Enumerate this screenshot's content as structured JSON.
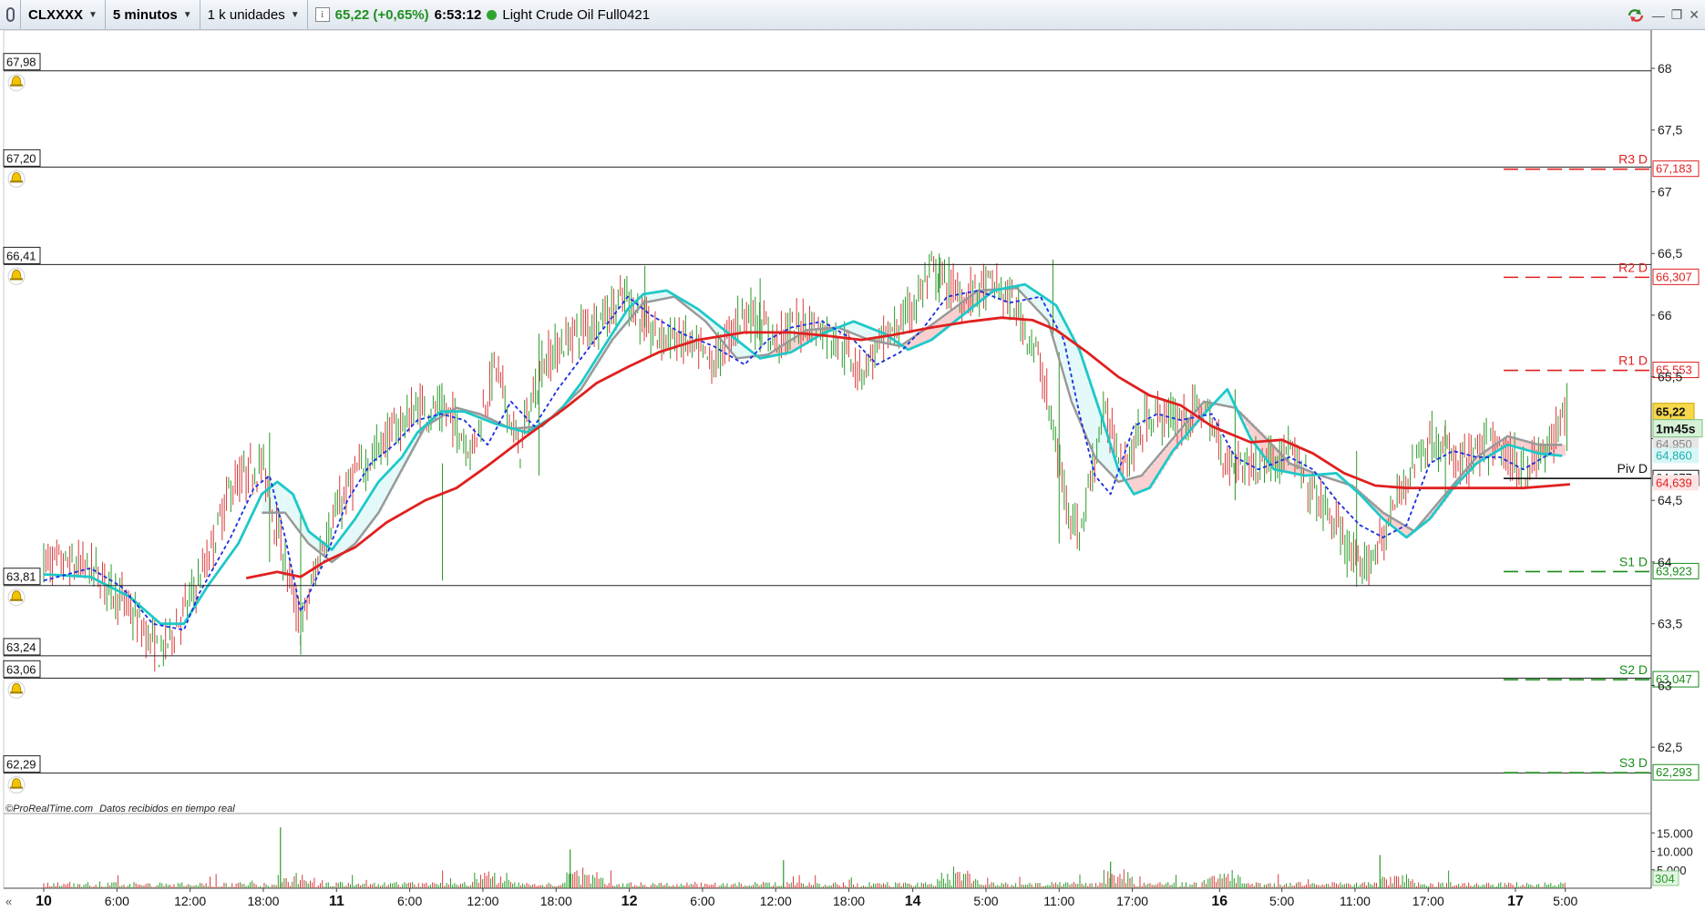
{
  "toolbar": {
    "symbol": "CLXXXX",
    "interval": "5 minutos",
    "units": "1 k unidades",
    "change": "65,22 (+0,65%)",
    "time": "6:53:12",
    "instrument": "Light Crude Oil Full0421"
  },
  "footer_note": {
    "brand": "©ProRealTime.com",
    "status": "Datos recibidos en tiempo real"
  },
  "colors": {
    "bull": "#2a9a2a",
    "bear": "#d83a3a",
    "ma_slow": "#e02020",
    "ma_cyan": "#1fc8c8",
    "ma_grey": "#999999",
    "dotted": "#1a2fe0",
    "resistance": "#e02020",
    "support": "#1a8c1a"
  },
  "chart_data": {
    "type": "line",
    "ylim": [
      61.97,
      68.31
    ],
    "y_ticks": [
      "68",
      "67,5",
      "67",
      "66,5",
      "66",
      "65,5",
      "65",
      "64,5",
      "64",
      "63,5",
      "63",
      "62,5"
    ],
    "x_ticks": [
      {
        "label": "10",
        "bold": true,
        "t": 0
      },
      {
        "label": "6:00",
        "bold": false,
        "t": 0.047
      },
      {
        "label": "12:00",
        "bold": false,
        "t": 0.094
      },
      {
        "label": "18:00",
        "bold": false,
        "t": 0.141
      },
      {
        "label": "11",
        "bold": true,
        "t": 0.188
      },
      {
        "label": "6:00",
        "bold": false,
        "t": 0.235
      },
      {
        "label": "12:00",
        "bold": false,
        "t": 0.282
      },
      {
        "label": "18:00",
        "bold": false,
        "t": 0.329
      },
      {
        "label": "12",
        "bold": true,
        "t": 0.376
      },
      {
        "label": "6:00",
        "bold": false,
        "t": 0.423
      },
      {
        "label": "12:00",
        "bold": false,
        "t": 0.47
      },
      {
        "label": "18:00",
        "bold": false,
        "t": 0.517
      },
      {
        "label": "14",
        "bold": true,
        "t": 0.558
      },
      {
        "label": "5:00",
        "bold": false,
        "t": 0.605
      },
      {
        "label": "11:00",
        "bold": false,
        "t": 0.652
      },
      {
        "label": "17:00",
        "bold": false,
        "t": 0.699
      },
      {
        "label": "16",
        "bold": true,
        "t": 0.755
      },
      {
        "label": "5:00",
        "bold": false,
        "t": 0.795
      },
      {
        "label": "11:00",
        "bold": false,
        "t": 0.842
      },
      {
        "label": "17:00",
        "bold": false,
        "t": 0.889
      },
      {
        "label": "17",
        "bold": true,
        "t": 0.945
      },
      {
        "label": "5:00",
        "bold": false,
        "t": 0.977
      }
    ],
    "alert_lines": [
      {
        "label": "67,98",
        "value": 67.98
      },
      {
        "label": "67,20",
        "value": 67.2
      },
      {
        "label": "66,41",
        "value": 66.41
      },
      {
        "label": "63,81",
        "value": 63.81
      },
      {
        "label": "63,24",
        "value": 63.24
      },
      {
        "label": "63,06",
        "value": 63.06
      },
      {
        "label": "62,29",
        "value": 62.29
      }
    ],
    "pivots": [
      {
        "name": "R3 D",
        "label": "67,183",
        "value": 67.183,
        "kind": "resistance"
      },
      {
        "name": "R2 D",
        "label": "66,307",
        "value": 66.307,
        "kind": "resistance"
      },
      {
        "name": "R1 D",
        "label": "65,553",
        "value": 65.553,
        "kind": "resistance"
      },
      {
        "name": "Piv D",
        "label": "64,677",
        "value": 64.677,
        "kind": "pivot"
      },
      {
        "name": "S1 D",
        "label": "63,923",
        "value": 63.923,
        "kind": "support"
      },
      {
        "name": "S2 D",
        "label": "63,047",
        "value": 63.047,
        "kind": "support"
      },
      {
        "name": "S3 D",
        "label": "62,293",
        "value": 62.293,
        "kind": "support"
      }
    ],
    "side_labels": [
      {
        "label": "64,950",
        "value": 64.95,
        "bg": "#e6e6e6",
        "fg": "#888888"
      },
      {
        "label": "64,860",
        "value": 64.86,
        "bg": "#d9f6f6",
        "fg": "#18b0b0"
      },
      {
        "label": "64,639",
        "value": 64.639,
        "bg": "#fde4e4",
        "fg": "#e02020"
      }
    ],
    "last_price": {
      "label": "65,22",
      "value": 65.22
    },
    "countdown": "1m45s",
    "ma_slow": [
      [
        0.13,
        63.87
      ],
      [
        0.15,
        63.92
      ],
      [
        0.165,
        63.88
      ],
      [
        0.18,
        64.0
      ],
      [
        0.2,
        64.12
      ],
      [
        0.22,
        64.32
      ],
      [
        0.245,
        64.5
      ],
      [
        0.265,
        64.6
      ],
      [
        0.285,
        64.78
      ],
      [
        0.31,
        65.02
      ],
      [
        0.335,
        65.25
      ],
      [
        0.355,
        65.45
      ],
      [
        0.375,
        65.58
      ],
      [
        0.395,
        65.7
      ],
      [
        0.42,
        65.8
      ],
      [
        0.45,
        65.86
      ],
      [
        0.48,
        65.86
      ],
      [
        0.505,
        65.83
      ],
      [
        0.525,
        65.8
      ],
      [
        0.545,
        65.84
      ],
      [
        0.57,
        65.9
      ],
      [
        0.595,
        65.95
      ],
      [
        0.615,
        65.98
      ],
      [
        0.635,
        65.96
      ],
      [
        0.65,
        65.88
      ],
      [
        0.67,
        65.7
      ],
      [
        0.69,
        65.5
      ],
      [
        0.71,
        65.35
      ],
      [
        0.73,
        65.27
      ],
      [
        0.75,
        65.1
      ],
      [
        0.775,
        64.97
      ],
      [
        0.795,
        64.99
      ],
      [
        0.815,
        64.88
      ],
      [
        0.835,
        64.72
      ],
      [
        0.855,
        64.62
      ],
      [
        0.875,
        64.6
      ],
      [
        0.9,
        64.6
      ],
      [
        0.93,
        64.6
      ],
      [
        0.95,
        64.6
      ],
      [
        0.97,
        64.62
      ],
      [
        0.98,
        64.63
      ]
    ],
    "ma_cyan": [
      [
        0.0,
        63.9
      ],
      [
        0.03,
        63.88
      ],
      [
        0.055,
        63.72
      ],
      [
        0.075,
        63.5
      ],
      [
        0.09,
        63.5
      ],
      [
        0.105,
        63.8
      ],
      [
        0.125,
        64.15
      ],
      [
        0.14,
        64.55
      ],
      [
        0.15,
        64.65
      ],
      [
        0.16,
        64.55
      ],
      [
        0.17,
        64.25
      ],
      [
        0.185,
        64.1
      ],
      [
        0.2,
        64.35
      ],
      [
        0.215,
        64.65
      ],
      [
        0.23,
        64.85
      ],
      [
        0.24,
        65.05
      ],
      [
        0.255,
        65.22
      ],
      [
        0.27,
        65.22
      ],
      [
        0.29,
        65.12
      ],
      [
        0.31,
        65.05
      ],
      [
        0.33,
        65.2
      ],
      [
        0.345,
        65.45
      ],
      [
        0.36,
        65.75
      ],
      [
        0.375,
        66.05
      ],
      [
        0.385,
        66.17
      ],
      [
        0.4,
        66.2
      ],
      [
        0.42,
        66.05
      ],
      [
        0.44,
        65.85
      ],
      [
        0.46,
        65.65
      ],
      [
        0.48,
        65.7
      ],
      [
        0.5,
        65.85
      ],
      [
        0.52,
        65.95
      ],
      [
        0.54,
        65.85
      ],
      [
        0.555,
        65.72
      ],
      [
        0.57,
        65.8
      ],
      [
        0.59,
        66.0
      ],
      [
        0.61,
        66.2
      ],
      [
        0.63,
        66.25
      ],
      [
        0.65,
        66.08
      ],
      [
        0.665,
        65.72
      ],
      [
        0.68,
        65.15
      ],
      [
        0.69,
        64.75
      ],
      [
        0.7,
        64.55
      ],
      [
        0.71,
        64.6
      ],
      [
        0.725,
        64.9
      ],
      [
        0.745,
        65.2
      ],
      [
        0.76,
        65.4
      ],
      [
        0.775,
        65.0
      ],
      [
        0.79,
        64.75
      ],
      [
        0.81,
        64.7
      ],
      [
        0.83,
        64.72
      ],
      [
        0.845,
        64.55
      ],
      [
        0.86,
        64.35
      ],
      [
        0.875,
        64.2
      ],
      [
        0.89,
        64.35
      ],
      [
        0.905,
        64.6
      ],
      [
        0.92,
        64.8
      ],
      [
        0.94,
        64.95
      ],
      [
        0.96,
        64.88
      ],
      [
        0.975,
        64.86
      ]
    ],
    "ma_grey": [
      [
        0.14,
        64.4
      ],
      [
        0.155,
        64.4
      ],
      [
        0.17,
        64.15
      ],
      [
        0.185,
        64.0
      ],
      [
        0.2,
        64.15
      ],
      [
        0.215,
        64.4
      ],
      [
        0.245,
        65.1
      ],
      [
        0.265,
        65.25
      ],
      [
        0.28,
        65.2
      ],
      [
        0.3,
        65.08
      ],
      [
        0.32,
        65.1
      ],
      [
        0.345,
        65.4
      ],
      [
        0.365,
        65.8
      ],
      [
        0.385,
        66.1
      ],
      [
        0.405,
        66.15
      ],
      [
        0.425,
        65.95
      ],
      [
        0.445,
        65.65
      ],
      [
        0.465,
        65.68
      ],
      [
        0.49,
        65.88
      ],
      [
        0.51,
        65.9
      ],
      [
        0.53,
        65.8
      ],
      [
        0.55,
        65.75
      ],
      [
        0.57,
        65.92
      ],
      [
        0.6,
        66.2
      ],
      [
        0.625,
        66.22
      ],
      [
        0.645,
        65.95
      ],
      [
        0.66,
        65.3
      ],
      [
        0.675,
        64.85
      ],
      [
        0.69,
        64.65
      ],
      [
        0.705,
        64.7
      ],
      [
        0.725,
        65.0
      ],
      [
        0.745,
        65.3
      ],
      [
        0.765,
        65.25
      ],
      [
        0.785,
        65.0
      ],
      [
        0.8,
        64.8
      ],
      [
        0.82,
        64.7
      ],
      [
        0.84,
        64.62
      ],
      [
        0.86,
        64.4
      ],
      [
        0.88,
        64.25
      ],
      [
        0.9,
        64.55
      ],
      [
        0.92,
        64.85
      ],
      [
        0.94,
        65.02
      ],
      [
        0.96,
        64.95
      ],
      [
        0.975,
        64.95
      ]
    ],
    "dotted": [
      [
        0.0,
        63.85
      ],
      [
        0.03,
        63.95
      ],
      [
        0.05,
        63.8
      ],
      [
        0.07,
        63.5
      ],
      [
        0.09,
        63.45
      ],
      [
        0.1,
        63.75
      ],
      [
        0.12,
        64.2
      ],
      [
        0.135,
        64.6
      ],
      [
        0.145,
        64.7
      ],
      [
        0.155,
        64.2
      ],
      [
        0.165,
        63.6
      ],
      [
        0.18,
        64.0
      ],
      [
        0.195,
        64.5
      ],
      [
        0.21,
        64.8
      ],
      [
        0.225,
        64.95
      ],
      [
        0.24,
        65.15
      ],
      [
        0.255,
        65.2
      ],
      [
        0.27,
        65.15
      ],
      [
        0.285,
        64.95
      ],
      [
        0.3,
        65.3
      ],
      [
        0.315,
        65.1
      ],
      [
        0.33,
        65.4
      ],
      [
        0.345,
        65.65
      ],
      [
        0.36,
        65.9
      ],
      [
        0.375,
        66.15
      ],
      [
        0.39,
        66.0
      ],
      [
        0.41,
        65.85
      ],
      [
        0.43,
        65.75
      ],
      [
        0.45,
        65.6
      ],
      [
        0.465,
        65.8
      ],
      [
        0.48,
        65.9
      ],
      [
        0.5,
        65.95
      ],
      [
        0.52,
        65.8
      ],
      [
        0.535,
        65.6
      ],
      [
        0.55,
        65.7
      ],
      [
        0.565,
        65.9
      ],
      [
        0.58,
        66.15
      ],
      [
        0.6,
        66.2
      ],
      [
        0.62,
        66.1
      ],
      [
        0.64,
        66.15
      ],
      [
        0.655,
        65.8
      ],
      [
        0.665,
        65.2
      ],
      [
        0.675,
        64.7
      ],
      [
        0.685,
        64.55
      ],
      [
        0.7,
        65.1
      ],
      [
        0.715,
        65.2
      ],
      [
        0.73,
        65.15
      ],
      [
        0.75,
        65.2
      ],
      [
        0.765,
        64.85
      ],
      [
        0.78,
        64.75
      ],
      [
        0.8,
        64.85
      ],
      [
        0.815,
        64.75
      ],
      [
        0.83,
        64.5
      ],
      [
        0.845,
        64.3
      ],
      [
        0.86,
        64.2
      ],
      [
        0.875,
        64.3
      ],
      [
        0.89,
        64.8
      ],
      [
        0.905,
        64.9
      ],
      [
        0.92,
        64.85
      ],
      [
        0.935,
        64.85
      ],
      [
        0.95,
        64.75
      ],
      [
        0.97,
        64.9
      ]
    ],
    "price_path": [
      [
        0.0,
        64.0
      ],
      [
        0.03,
        63.95
      ],
      [
        0.05,
        63.7
      ],
      [
        0.075,
        63.25
      ],
      [
        0.09,
        63.6
      ],
      [
        0.105,
        64.0
      ],
      [
        0.12,
        64.6
      ],
      [
        0.14,
        64.8
      ],
      [
        0.155,
        64.0
      ],
      [
        0.165,
        63.45
      ],
      [
        0.18,
        64.2
      ],
      [
        0.2,
        64.7
      ],
      [
        0.22,
        65.0
      ],
      [
        0.24,
        65.25
      ],
      [
        0.26,
        65.2
      ],
      [
        0.275,
        64.9
      ],
      [
        0.29,
        65.6
      ],
      [
        0.305,
        64.9
      ],
      [
        0.32,
        65.6
      ],
      [
        0.34,
        65.85
      ],
      [
        0.36,
        66.0
      ],
      [
        0.375,
        66.15
      ],
      [
        0.39,
        65.85
      ],
      [
        0.41,
        65.8
      ],
      [
        0.43,
        65.6
      ],
      [
        0.45,
        66.05
      ],
      [
        0.47,
        65.8
      ],
      [
        0.49,
        65.95
      ],
      [
        0.51,
        65.8
      ],
      [
        0.525,
        65.55
      ],
      [
        0.54,
        65.8
      ],
      [
        0.555,
        66.0
      ],
      [
        0.57,
        66.35
      ],
      [
        0.59,
        66.15
      ],
      [
        0.61,
        66.25
      ],
      [
        0.625,
        66.05
      ],
      [
        0.64,
        65.6
      ],
      [
        0.655,
        64.6
      ],
      [
        0.665,
        64.2
      ],
      [
        0.68,
        65.2
      ],
      [
        0.695,
        64.8
      ],
      [
        0.71,
        65.2
      ],
      [
        0.73,
        65.15
      ],
      [
        0.745,
        65.25
      ],
      [
        0.76,
        64.8
      ],
      [
        0.78,
        64.8
      ],
      [
        0.8,
        64.9
      ],
      [
        0.815,
        64.55
      ],
      [
        0.83,
        64.3
      ],
      [
        0.845,
        63.9
      ],
      [
        0.86,
        64.2
      ],
      [
        0.875,
        64.7
      ],
      [
        0.89,
        65.0
      ],
      [
        0.91,
        64.8
      ],
      [
        0.93,
        64.95
      ],
      [
        0.95,
        64.75
      ],
      [
        0.965,
        64.9
      ],
      [
        0.978,
        65.22
      ]
    ],
    "volume_scale": [
      "15.000",
      "10.000",
      "5.000"
    ],
    "volume_current": "304",
    "volume_max": 20000
  }
}
